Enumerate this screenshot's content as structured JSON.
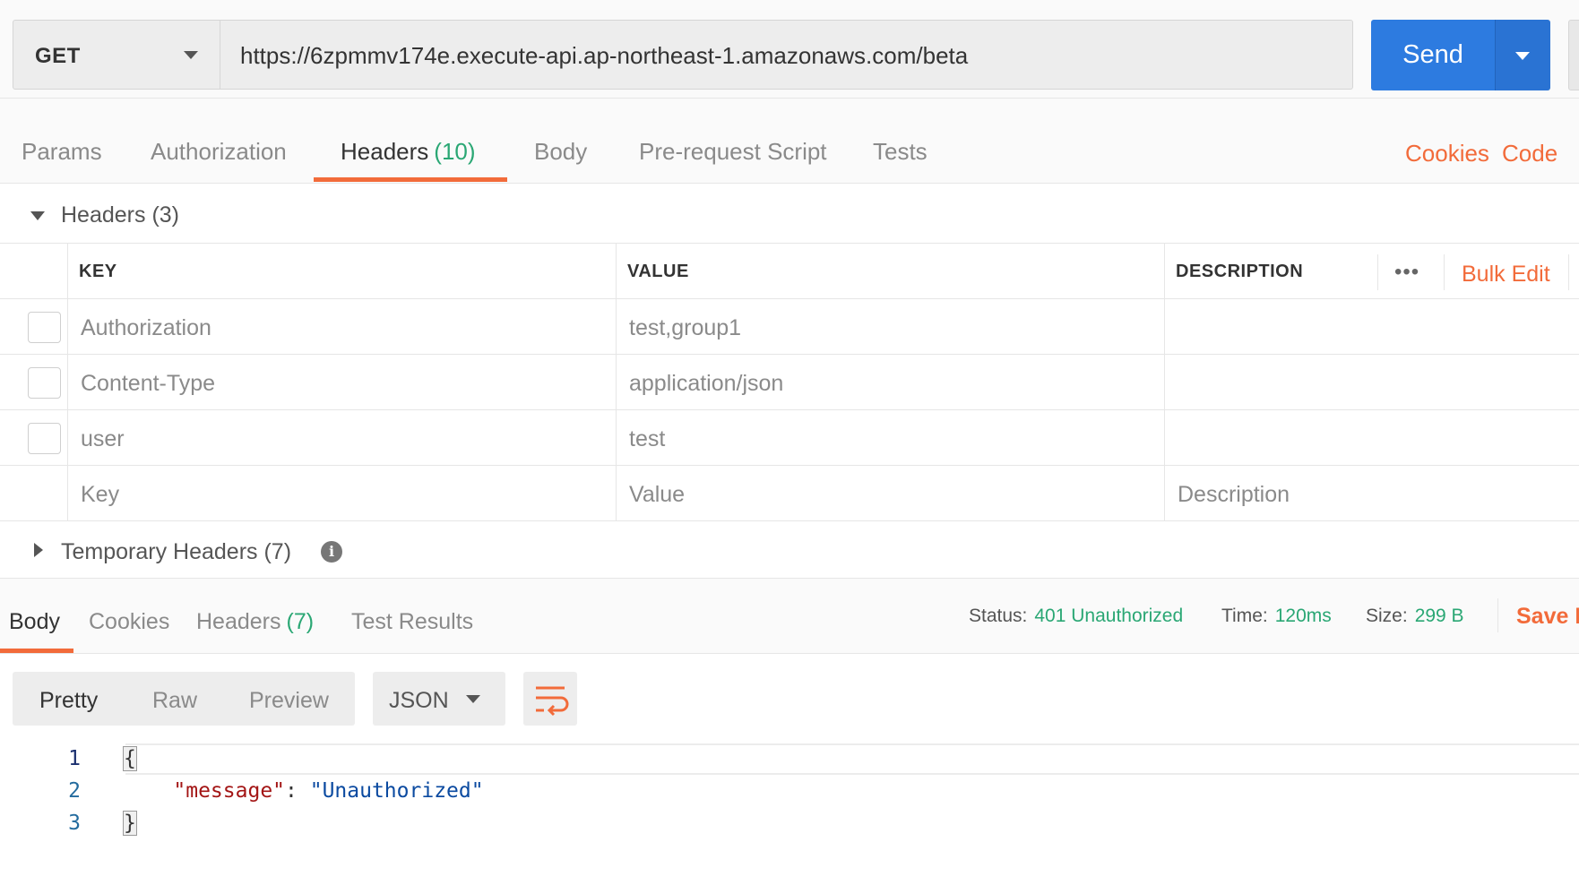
{
  "request": {
    "method": "GET",
    "url": "https://6zpmmv174e.execute-api.ap-northeast-1.amazonaws.com/beta",
    "send_label": "Send"
  },
  "request_tabs": [
    {
      "label": "Params",
      "count": ""
    },
    {
      "label": "Authorization",
      "count": ""
    },
    {
      "label": "Headers",
      "count": "(10)"
    },
    {
      "label": "Body",
      "count": ""
    },
    {
      "label": "Pre-request Script",
      "count": ""
    },
    {
      "label": "Tests",
      "count": ""
    }
  ],
  "request_links": {
    "cookies": "Cookies",
    "code": "Code"
  },
  "headers_section": {
    "title": "Headers (3)",
    "columns": {
      "key": "KEY",
      "value": "VALUE",
      "description": "DESCRIPTION"
    },
    "more_label": "•••",
    "bulk_edit": "Bulk Edit",
    "rows": [
      {
        "key": "Authorization",
        "value": "test,group1",
        "description": ""
      },
      {
        "key": "Content-Type",
        "value": "application/json",
        "description": ""
      },
      {
        "key": "user",
        "value": "test",
        "description": ""
      }
    ],
    "placeholders": {
      "key": "Key",
      "value": "Value",
      "description": "Description"
    }
  },
  "temporary_headers": {
    "title": "Temporary Headers (7)",
    "info": "i"
  },
  "response_tabs": [
    {
      "label": "Body",
      "count": ""
    },
    {
      "label": "Cookies",
      "count": ""
    },
    {
      "label": "Headers",
      "count": "(7)"
    },
    {
      "label": "Test Results",
      "count": ""
    }
  ],
  "response_meta": {
    "status_label": "Status:",
    "status_value": "401 Unauthorized",
    "time_label": "Time:",
    "time_value": "120ms",
    "size_label": "Size:",
    "size_value": "299 B",
    "save_label": "Save R"
  },
  "view_modes": [
    "Pretty",
    "Raw",
    "Preview"
  ],
  "format": "JSON",
  "code_lines": [
    {
      "num": "1",
      "text": "{"
    },
    {
      "num": "2",
      "key": "\"message\"",
      "sep": ": ",
      "value": "\"Unauthorized\""
    },
    {
      "num": "3",
      "text": "}"
    }
  ],
  "colors": {
    "accent": "#f26b3a",
    "primary": "#2d7be0",
    "success": "#2aa774"
  }
}
